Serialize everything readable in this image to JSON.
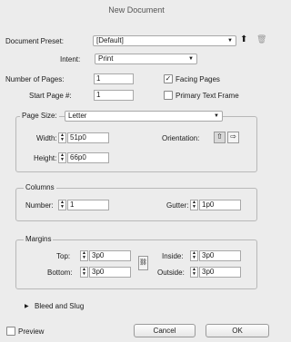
{
  "window": {
    "title": "New Document"
  },
  "document_preset": {
    "label": "Document Preset:",
    "value": "[Default]"
  },
  "intent": {
    "label": "Intent:",
    "value": "Print"
  },
  "number_of_pages": {
    "label": "Number of Pages:",
    "value": "1"
  },
  "start_page": {
    "label": "Start Page #:",
    "value": "1"
  },
  "facing_pages": {
    "label": "Facing Pages",
    "checked": true
  },
  "primary_text_frame": {
    "label": "Primary Text Frame",
    "checked": false
  },
  "page_size": {
    "label": "Page Size:",
    "value": "Letter",
    "width": {
      "label": "Width:",
      "value": "51p0"
    },
    "height": {
      "label": "Height:",
      "value": "66p0"
    },
    "orientation_label": "Orientation:"
  },
  "columns": {
    "title": "Columns",
    "number": {
      "label": "Number:",
      "value": "1"
    },
    "gutter": {
      "label": "Gutter:",
      "value": "1p0"
    }
  },
  "margins": {
    "title": "Margins",
    "top": {
      "label": "Top:",
      "value": "3p0"
    },
    "bottom": {
      "label": "Bottom:",
      "value": "3p0"
    },
    "inside": {
      "label": "Inside:",
      "value": "3p0"
    },
    "outside": {
      "label": "Outside:",
      "value": "3p0"
    }
  },
  "bleed_and_slug": {
    "label": "Bleed and Slug"
  },
  "preview": {
    "label": "Preview",
    "checked": false
  },
  "buttons": {
    "cancel": "Cancel",
    "ok": "OK"
  },
  "glyphs": {
    "check": "✓",
    "arrow_down": "▼",
    "disclosure": "▶",
    "step_up": "▲",
    "step_down": "▼",
    "save": "⬆",
    "trash": "🗑",
    "portrait": "⇧",
    "landscape": "⇨",
    "link": "⛓"
  }
}
